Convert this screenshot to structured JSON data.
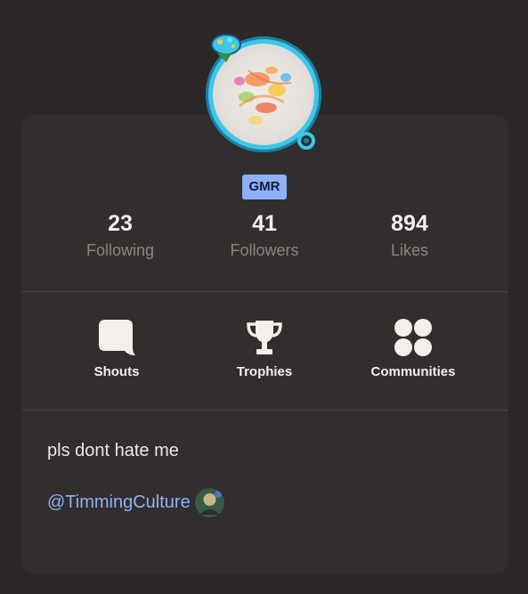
{
  "profile": {
    "badge": "GMR",
    "bio": "pls dont hate me",
    "mention": "@TimmingCulture"
  },
  "stats": [
    {
      "value": "23",
      "label": "Following"
    },
    {
      "value": "41",
      "label": "Followers"
    },
    {
      "value": "894",
      "label": "Likes"
    }
  ],
  "actions": [
    {
      "label": "Shouts",
      "icon": "speech-bubble-icon"
    },
    {
      "label": "Trophies",
      "icon": "trophy-icon"
    },
    {
      "label": "Communities",
      "icon": "four-circles-icon"
    }
  ],
  "colors": {
    "background": "#2b2827",
    "card": "#312e2d",
    "accent": "#8fb0f5",
    "avatar_ring": "#3cc6ea"
  }
}
